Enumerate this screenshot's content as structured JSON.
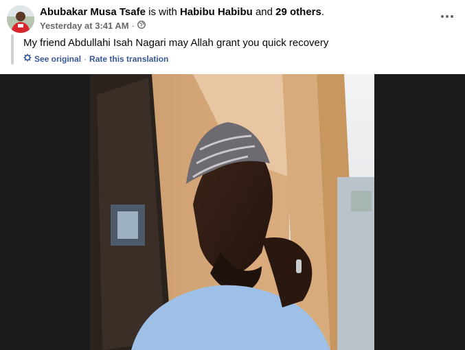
{
  "post": {
    "author": "Abubakar Musa Tsafe",
    "is_with": "is with",
    "tagged": "Habibu Habibu",
    "and_text": "and",
    "others": "29 others",
    "period": ".",
    "timestamp": "Yesterday at 3:41 AM",
    "separator": "·",
    "text": "My friend Abdullahi Isah Nagari may Allah grant you quick recovery",
    "see_original": "See original",
    "rate_translation": "Rate this translation"
  },
  "icons": {
    "globe": "globe-icon",
    "gear": "gear-icon",
    "more": "more-options-icon"
  },
  "colors": {
    "link": "#385898",
    "meta": "#65676b",
    "photo_background": "#1b1b1b"
  }
}
